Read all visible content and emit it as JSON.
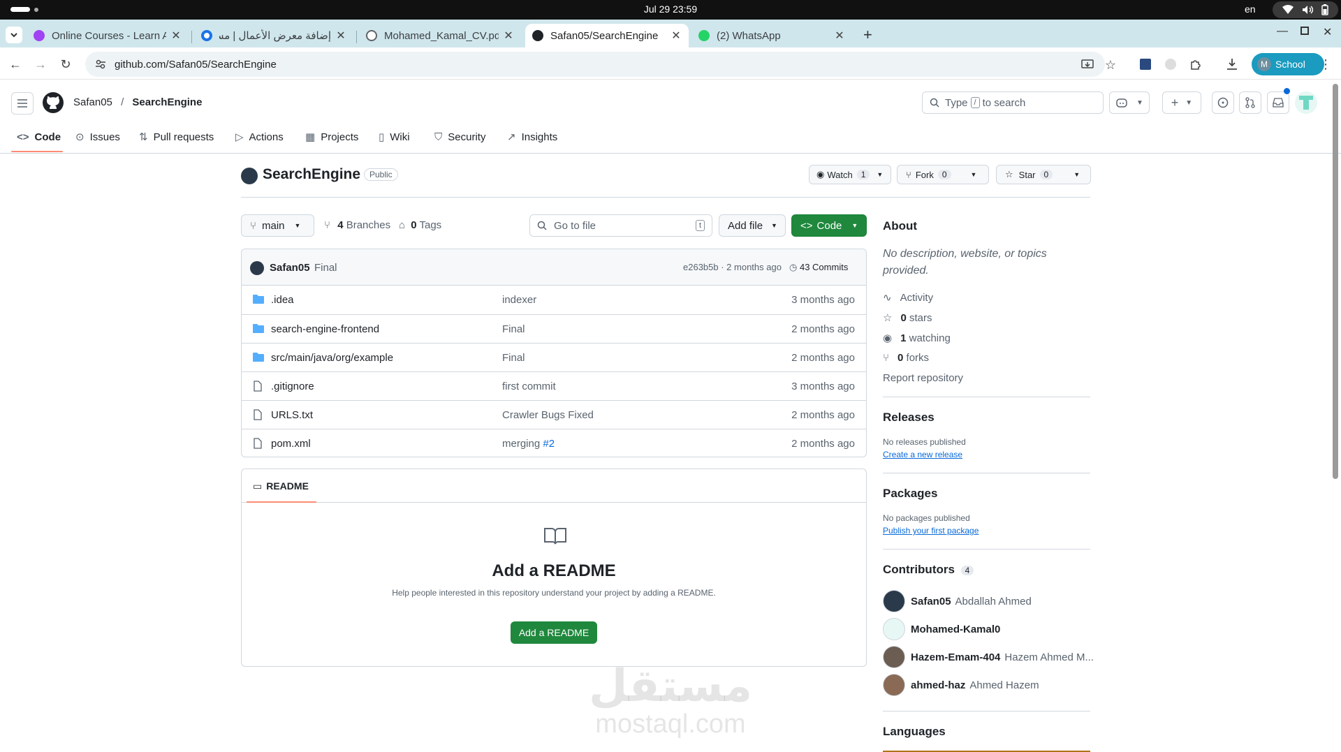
{
  "os": {
    "clock": "Jul 29  23:59",
    "lang": "en"
  },
  "browser": {
    "tabs": [
      {
        "title": "Online Courses - Learn A",
        "color": "#a142f4"
      },
      {
        "title": "إضافة معرض الأعمال | مس",
        "color": "#1a73e8"
      },
      {
        "title": "Mohamed_Kamal_CV.pdf",
        "color": "#5f6368"
      },
      {
        "title": "Safan05/SearchEngine",
        "color": "#1f2328"
      },
      {
        "title": "(2) WhatsApp",
        "color": "#25d366"
      }
    ],
    "url": "github.com/Safan05/SearchEngine",
    "profile_initial": "M",
    "profile_label": "School"
  },
  "github": {
    "owner": "Safan05",
    "repo": "SearchEngine",
    "search_placeholder_pre": "Type",
    "search_key": "/",
    "search_placeholder_post": "to search",
    "nav": [
      "Code",
      "Issues",
      "Pull requests",
      "Actions",
      "Projects",
      "Wiki",
      "Security",
      "Insights"
    ]
  },
  "repo": {
    "name": "SearchEngine",
    "visibility": "Public",
    "watch_label": "Watch",
    "watch_count": "1",
    "fork_label": "Fork",
    "fork_count": "0",
    "star_label": "Star",
    "star_count": "0",
    "branch": "main",
    "branches_count": "4",
    "branches_label": "Branches",
    "tags_count": "0",
    "tags_label": "Tags",
    "goto_placeholder": "Go to file",
    "goto_key": "t",
    "add_file": "Add file",
    "code_button": "Code"
  },
  "commit": {
    "author": "Safan05",
    "message": "Final",
    "hash_time": "e263b5b · 2 months ago",
    "commits": "43 Commits"
  },
  "files": [
    {
      "type": "folder",
      "name": ".idea",
      "message": "indexer",
      "link": "",
      "time": "3 months ago"
    },
    {
      "type": "folder",
      "name": "search-engine-frontend",
      "message": "Final",
      "link": "",
      "time": "2 months ago"
    },
    {
      "type": "folder",
      "name": "src/main/java/org/example",
      "message": "Final",
      "link": "",
      "time": "2 months ago"
    },
    {
      "type": "file",
      "name": ".gitignore",
      "message": "first commit",
      "link": "",
      "time": "3 months ago"
    },
    {
      "type": "file",
      "name": "URLS.txt",
      "message": "Crawler Bugs Fixed",
      "link": "",
      "time": "2 months ago"
    },
    {
      "type": "file",
      "name": "pom.xml",
      "message": "merging",
      "link": "#2",
      "time": "2 months ago"
    }
  ],
  "readme": {
    "tab": "README",
    "title": "Add a README",
    "desc": "Help people interested in this repository understand your project by adding a README.",
    "button": "Add a README"
  },
  "about": {
    "heading": "About",
    "desc": "No description, website, or topics provided.",
    "activity": "Activity",
    "stars_n": "0",
    "stars_l": "stars",
    "watching_n": "1",
    "watching_l": "watching",
    "forks_n": "0",
    "forks_l": "forks",
    "report": "Report repository"
  },
  "releases": {
    "heading": "Releases",
    "text": "No releases published",
    "link": "Create a new release"
  },
  "packages": {
    "heading": "Packages",
    "text": "No packages published",
    "link": "Publish your first package"
  },
  "contributors": {
    "heading": "Contributors",
    "count": "4",
    "list": [
      {
        "login": "Safan05",
        "name": "Abdallah Ahmed"
      },
      {
        "login": "Mohamed-Kamal0",
        "name": ""
      },
      {
        "login": "Hazem-Emam-404",
        "name": "Hazem Ahmed M..."
      },
      {
        "login": "ahmed-haz",
        "name": "Ahmed Hazem"
      }
    ]
  },
  "languages": {
    "heading": "Languages"
  },
  "watermark": {
    "arabic": "مستقل",
    "latin": "mostaql.com"
  }
}
